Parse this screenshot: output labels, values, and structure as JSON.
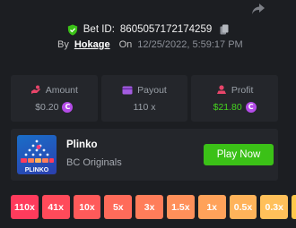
{
  "bet": {
    "id_label": "Bet ID:",
    "id": "8605057172174259",
    "by_label": "By",
    "user": "Hokage",
    "on_label": "On",
    "datetime": "12/25/2022, 5:59:17 PM"
  },
  "stats": {
    "amount": {
      "label": "Amount",
      "value": "$0.20",
      "icon": "money-icon"
    },
    "payout": {
      "label": "Payout",
      "value": "110 x",
      "icon": "card-icon"
    },
    "profit": {
      "label": "Profit",
      "value": "$21.80",
      "icon": "profit-icon"
    }
  },
  "coin_glyph": "C",
  "game": {
    "name": "Plinko",
    "provider": "BC Originals",
    "play_label": "Play Now",
    "thumb_text": "PLINKO"
  },
  "multipliers": [
    {
      "label": "110x",
      "color": "#ff3b5c"
    },
    {
      "label": "41x",
      "color": "#ff4a5a"
    },
    {
      "label": "10x",
      "color": "#ff5a5a"
    },
    {
      "label": "5x",
      "color": "#ff6b5a"
    },
    {
      "label": "3x",
      "color": "#ff7d5a"
    },
    {
      "label": "1.5x",
      "color": "#ff905a"
    },
    {
      "label": "1x",
      "color": "#ffa25a"
    },
    {
      "label": "0.5x",
      "color": "#ffb35a"
    },
    {
      "label": "0.3x",
      "color": "#ffc05a"
    }
  ],
  "colors": {
    "background": "#1c1e22",
    "panel": "#24262b",
    "accent_green": "#3bc117",
    "profit_green": "#45d41f",
    "coin_purple": "#b44ce8",
    "multiplier_cutoff": "#ffc84a"
  }
}
